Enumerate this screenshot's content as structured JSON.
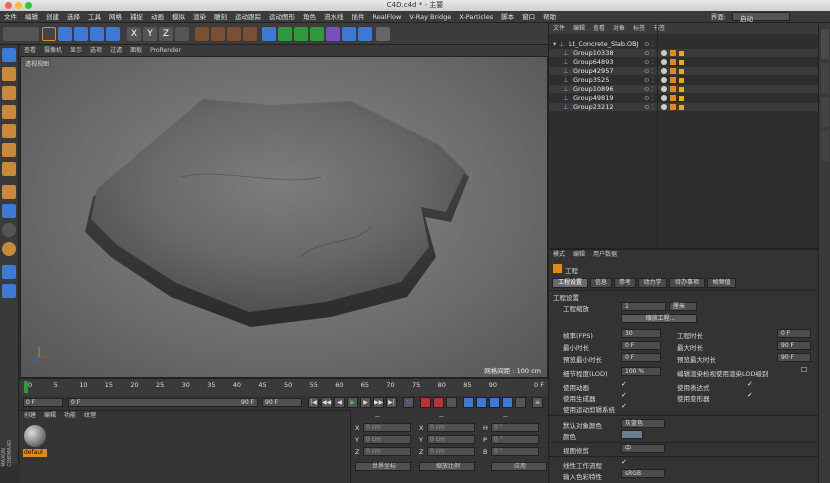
{
  "window": {
    "title": "C4D.c4d * - 主要",
    "layout_label": "界面:",
    "layout_value": "启动"
  },
  "menubar": [
    "文件",
    "编辑",
    "创建",
    "选择",
    "工具",
    "网格",
    "捕捉",
    "动画",
    "模拟",
    "渲染",
    "雕刻",
    "运动跟踪",
    "运动图形",
    "角色",
    "流水线",
    "插件",
    "RealFlow",
    "V-Ray Bridge",
    "X-Particles",
    "脚本",
    "窗口",
    "帮助"
  ],
  "viewport": {
    "menu": [
      "查看",
      "摄像机",
      "显示",
      "选项",
      "过滤",
      "面板",
      "ProRender"
    ],
    "label": "透视视图",
    "grid_label": "网格间距 : 100 cm"
  },
  "timeline": {
    "ticks": [
      "0",
      "5",
      "10",
      "15",
      "20",
      "25",
      "30",
      "35",
      "40",
      "45",
      "50",
      "55",
      "60",
      "65",
      "70",
      "75",
      "80",
      "85",
      "90"
    ],
    "end_marker": "0 F",
    "start_field": "0 F",
    "current_field": "0 F",
    "end_field": "90 F",
    "end_field2": "90 F"
  },
  "material": {
    "menu": [
      "创建",
      "编辑",
      "功能",
      "纹理"
    ],
    "item_label": "defaul"
  },
  "coordinates": {
    "col_headers": [
      "--",
      "--",
      "--"
    ],
    "rows": [
      {
        "axis": "X",
        "pos": "0 cm",
        "axis2": "X",
        "size": "0 cm",
        "axis3": "H",
        "rot": "0 °"
      },
      {
        "axis": "Y",
        "pos": "0 cm",
        "axis2": "Y",
        "size": "0 cm",
        "axis3": "P",
        "rot": "0 °"
      },
      {
        "axis": "Z",
        "pos": "0 cm",
        "axis2": "Z",
        "size": "0 cm",
        "axis3": "B",
        "rot": "0 °"
      }
    ],
    "world_select": "世界坐标",
    "scale_select": "缩放比例",
    "apply_button": "应用"
  },
  "object_manager": {
    "menu": [
      "文件",
      "编辑",
      "查看",
      "对象",
      "标签",
      "书签"
    ],
    "root": "Lt_Concrete_Slab.OBJ",
    "groups": [
      "Group10338",
      "Group64893",
      "Group42957",
      "Group3525",
      "Group10896",
      "Group49819",
      "Group23212"
    ]
  },
  "attributes": {
    "menu": [
      "模式",
      "编辑",
      "用户数据"
    ],
    "title": "工程",
    "tabs": [
      "工程设置",
      "信息",
      "参考",
      "动力学",
      "待办事项",
      "帧频值"
    ],
    "section": "工程设置",
    "scale_label": "工程缩放",
    "scale_value": "1",
    "scale_unit": "厘米",
    "scale_button": "缩放工程...",
    "fps_label": "帧率(FPS)",
    "fps_value": "30",
    "project_time_label": "工程时长",
    "project_time_value": "0 F",
    "min_time_label": "最小时长",
    "min_time_value": "0 F",
    "max_time_label": "最大时长",
    "max_time_value": "90 F",
    "preview_min_label": "预览最小时长",
    "preview_min_value": "0 F",
    "preview_max_label": "预览最大时长",
    "preview_max_value": "90 F",
    "lod_label": "细节程度(LOD)",
    "lod_value": "100 %",
    "lod_render_label": "编辑渲染检视使用渲染LOD级别",
    "use_anim": "使用动画",
    "use_expr": "使用表达式",
    "use_gen": "使用生成器",
    "use_deform": "使用变形器",
    "use_motion": "使用运动剪辑系统",
    "default_color_label": "默认对象颜色",
    "default_color_value": "灰蓝色",
    "color_label": "颜色",
    "view_clip_label": "视图修剪",
    "view_clip_value": "中",
    "linear_wf_label": "线性工作流程",
    "input_color_label": "输入色彩特性",
    "input_color_value": "sRGB"
  },
  "colors": {
    "accent_blue": "#3d7ad6",
    "slab": "#6f6f6f",
    "node_orange": "#e08a1c"
  }
}
